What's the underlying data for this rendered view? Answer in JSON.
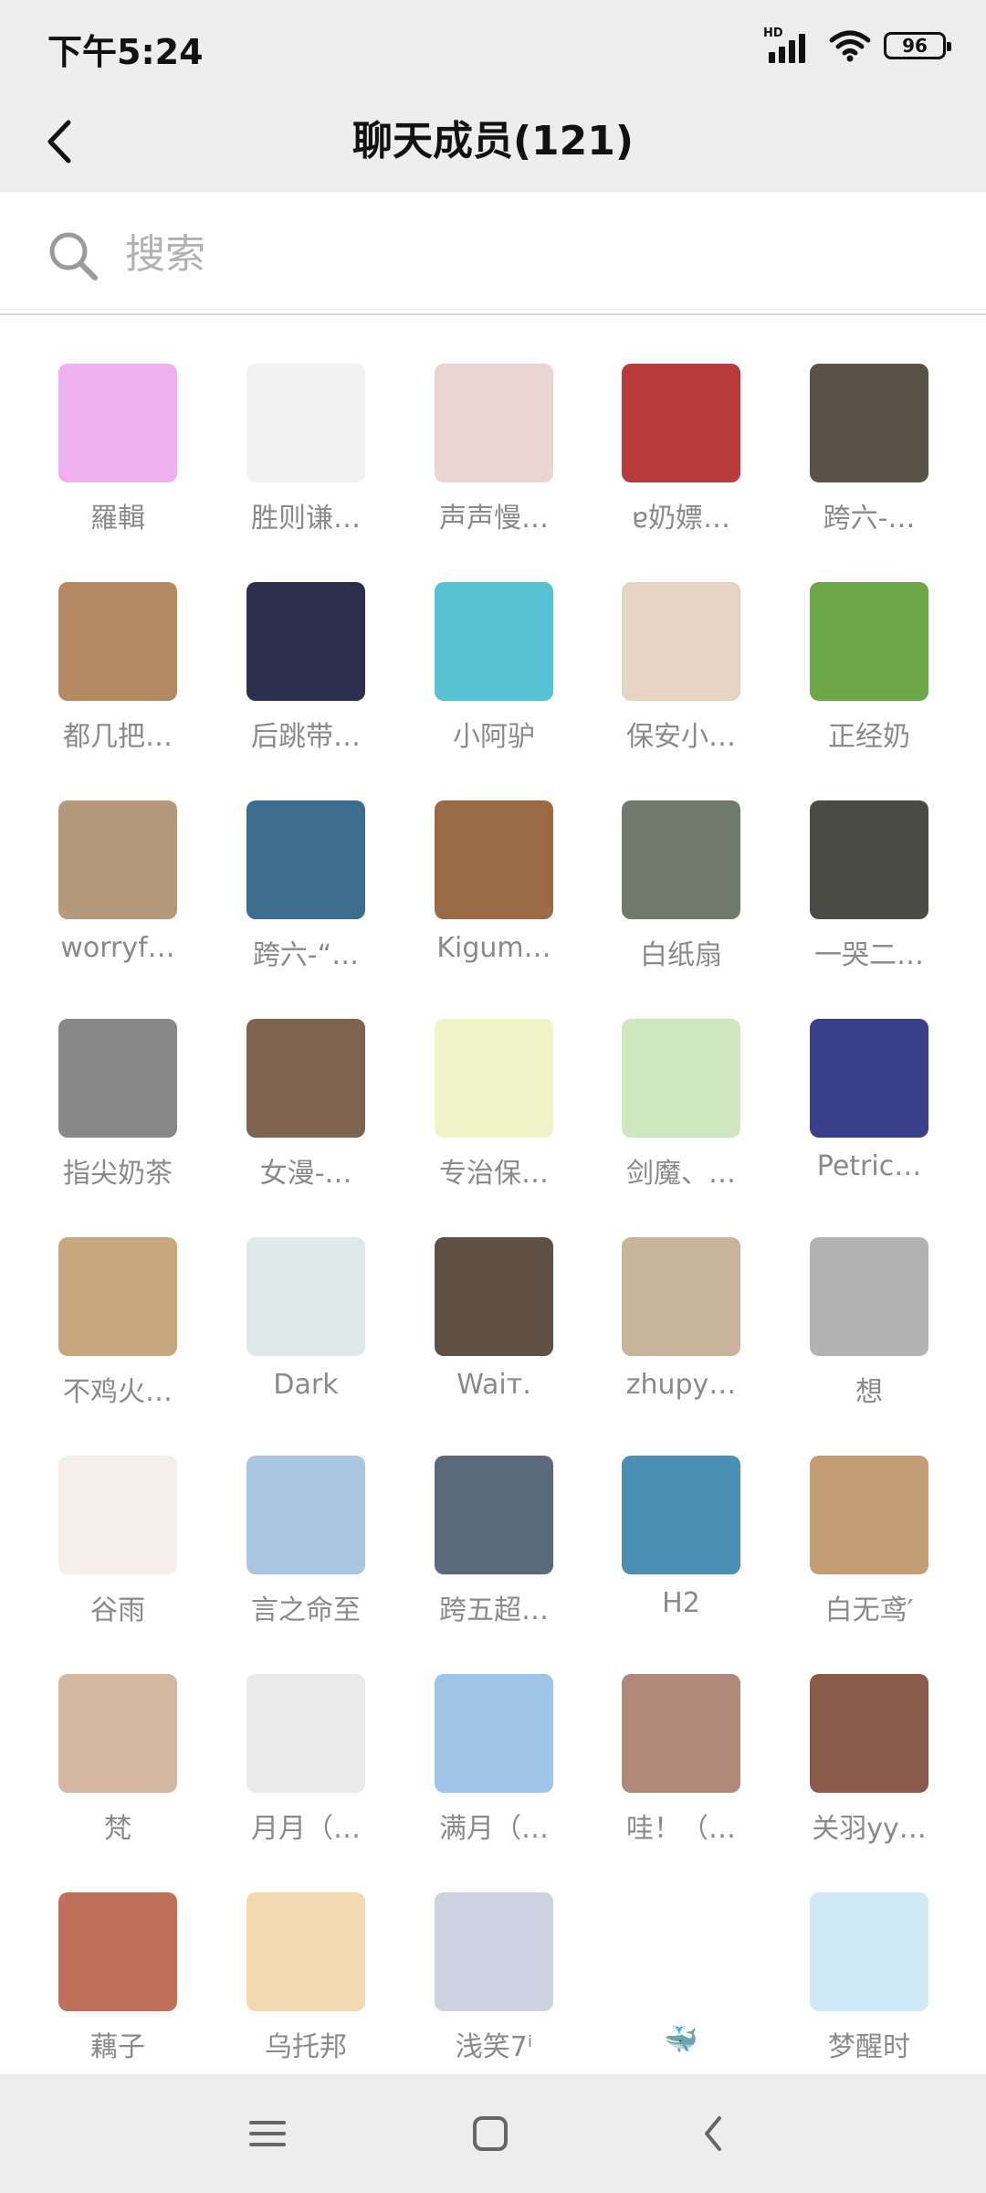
{
  "status_bar": {
    "time": "下午5:24",
    "network_label": "HD",
    "battery": "96"
  },
  "header": {
    "title": "聊天成员(121)"
  },
  "search": {
    "placeholder": "搜索"
  },
  "members": [
    {
      "name": "羅輯",
      "bg": "#f0b0f0"
    },
    {
      "name": "胜则谦…",
      "bg": "#f2f2f2"
    },
    {
      "name": "声声慢…",
      "bg": "#e9d6d3"
    },
    {
      "name": "ɐ奶嫖…",
      "bg": "#b83a3a"
    },
    {
      "name": "跨六-…",
      "bg": "#5a5247"
    },
    {
      "name": "都几把…",
      "bg": "#b58a63"
    },
    {
      "name": "后跳带…",
      "bg": "#2c2f4d"
    },
    {
      "name": "小阿驴",
      "bg": "#58c2d4"
    },
    {
      "name": "保安小…",
      "bg": "#e6d4c3"
    },
    {
      "name": "正经奶",
      "bg": "#6ea64a"
    },
    {
      "name": "worryf…",
      "bg": "#b49a7a"
    },
    {
      "name": "跨六-“…",
      "bg": "#3c6c8e"
    },
    {
      "name": "Kigum…",
      "bg": "#9a6a45"
    },
    {
      "name": "白纸扇",
      "bg": "#6f7a6a"
    },
    {
      "name": "一哭二…",
      "bg": "#4b4b45"
    },
    {
      "name": "指尖奶茶",
      "bg": "#888888"
    },
    {
      "name": "女漫-…",
      "bg": "#7d6350"
    },
    {
      "name": "专治保…",
      "bg": "#eef3c8"
    },
    {
      "name": "剑魔、…",
      "bg": "#cfe6c1"
    },
    {
      "name": "Petric…",
      "bg": "#3b3f8a"
    },
    {
      "name": "不鸡火…",
      "bg": "#c9a77e"
    },
    {
      "name": "Dark",
      "bg": "#dfe9e7"
    },
    {
      "name": "Waiт.",
      "bg": "#5e5044"
    },
    {
      "name": "zhupy…",
      "bg": "#c9b39a"
    },
    {
      "name": "想",
      "bg": "#b3b3b3"
    },
    {
      "name": "谷雨",
      "bg": "#f4efe9"
    },
    {
      "name": "言之命至",
      "bg": "#aac6e0"
    },
    {
      "name": "跨五超…",
      "bg": "#5b6a7a"
    },
    {
      "name": "H2",
      "bg": "#4c8fb2"
    },
    {
      "name": "白无鸢′",
      "bg": "#c39c74"
    },
    {
      "name": "梵",
      "bg": "#d2b8a1"
    },
    {
      "name": "月月（…",
      "bg": "#eaeaea"
    },
    {
      "name": "满月（…",
      "bg": "#9fc4e6"
    },
    {
      "name": "哇！（…",
      "bg": "#b1897a"
    },
    {
      "name": "关羽yy…",
      "bg": "#8a5a4b"
    },
    {
      "name": "藕子",
      "bg": "#c07058"
    },
    {
      "name": "乌托邦",
      "bg": "#f2d9b0"
    },
    {
      "name": "浅笑7ⁱ",
      "bg": "#cdd3e1"
    },
    {
      "name": "🐳",
      "bg": "#ffffff"
    },
    {
      "name": "梦醒时",
      "bg": "#cfe9f5"
    }
  ],
  "bottom_nav": {
    "menu_icon": "menu-icon",
    "home_icon": "home-icon",
    "back_icon": "back-icon"
  }
}
